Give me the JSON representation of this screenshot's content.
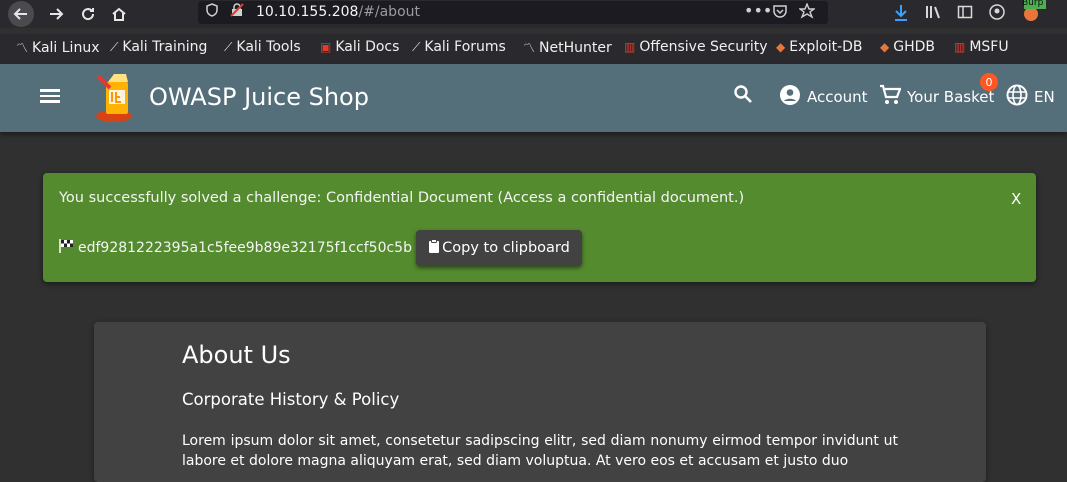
{
  "browser": {
    "url_host": "10.10.155.208",
    "url_path": "/#/about",
    "burp_label": "Burp"
  },
  "bookmarks": [
    {
      "label": "Kali Linux",
      "icon": "kali-dragon-icon"
    },
    {
      "label": "Kali Training",
      "icon": "kali-dragon-icon"
    },
    {
      "label": "Kali Tools",
      "icon": "kali-dragon-icon"
    },
    {
      "label": "Kali Docs",
      "icon": "kali-docs-icon"
    },
    {
      "label": "Kali Forums",
      "icon": "kali-dragon-icon"
    },
    {
      "label": "NetHunter",
      "icon": "nethunter-icon"
    },
    {
      "label": "Offensive Security",
      "icon": "offsec-icon"
    },
    {
      "label": "Exploit-DB",
      "icon": "exploitdb-icon"
    },
    {
      "label": "GHDB",
      "icon": "ghdb-icon"
    },
    {
      "label": "MSFU",
      "icon": "offsec-icon"
    }
  ],
  "app_bar": {
    "title": "OWASP Juice Shop",
    "account_label": "Account",
    "basket_label": "Your Basket",
    "basket_count": "0",
    "language": "EN"
  },
  "snackbar": {
    "message": "You successfully solved a challenge: Confidential Document (Access a confidential document.)",
    "close_label": "X",
    "flag_code": "edf9281222395a1c5fee9b89e32175f1ccf50c5b",
    "copy_label": "Copy to clipboard"
  },
  "about": {
    "title": "About Us",
    "subtitle": "Corporate History & Policy",
    "body": "Lorem ipsum dolor sit amet, consetetur sadipscing elitr, sed diam nonumy eirmod tempor invidunt ut labore et dolore magna aliquyam erat, sed diam voluptua. At vero eos et accusam et justo duo"
  },
  "colors": {
    "app_bar": "#546e7a",
    "snackbar_success": "#558b2f",
    "basket_badge": "#ff5722",
    "background": "#303030",
    "card": "#424242"
  }
}
